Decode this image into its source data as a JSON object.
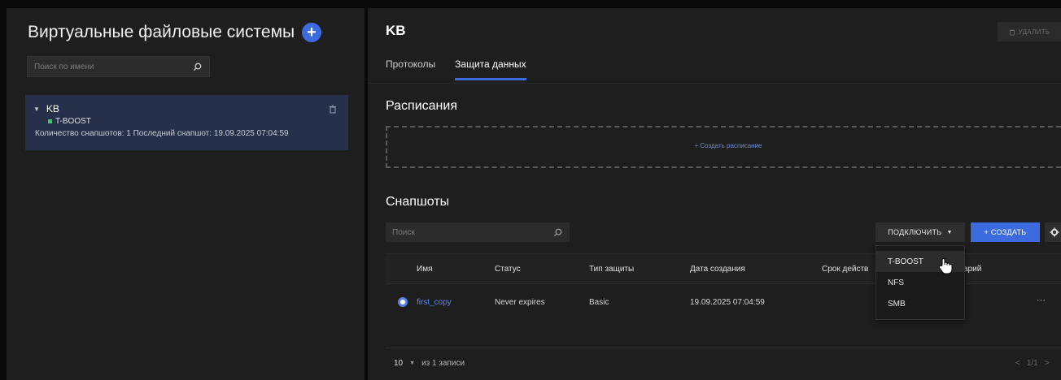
{
  "left": {
    "title": "Виртуальные файловые системы",
    "search_placeholder": "Поиск по имени",
    "fs_item": {
      "name": "KB",
      "badge": "T-BOOST",
      "meta": "Количество снапшотов: 1 Последний снапшот: 19.09.2025 07:04:59"
    }
  },
  "right": {
    "title": "KB",
    "delete_label": "УДАЛИТЬ",
    "tabs": [
      {
        "label": "Протоколы"
      },
      {
        "label": "Защита данных"
      }
    ],
    "schedules": {
      "heading": "Расписания",
      "create_label": "+ Создать расписание"
    },
    "snapshots": {
      "heading": "Снапшоты",
      "search_placeholder": "Поиск",
      "connect_label": "ПОДКЛЮЧИТЬ",
      "create_label": "+ СОЗДАТЬ",
      "columns": [
        "Имя",
        "Статус",
        "Тип защиты",
        "Дата создания",
        "Срок действ",
        "арий"
      ],
      "rows": [
        {
          "name": "first_copy",
          "status": "Never expires",
          "type": "Basic",
          "created": "19.09.2025 07:04:59",
          "menu": "···"
        }
      ],
      "page_size": "10",
      "total_label": "из 1 записи",
      "pager": "1/1"
    },
    "connect_menu": [
      "T-BOOST",
      "NFS",
      "SMB"
    ]
  },
  "colors": {
    "accent": "#3c6be0",
    "panel": "#1e1e1e",
    "selected_card": "#27304a",
    "badge_green": "#3fc86a"
  }
}
